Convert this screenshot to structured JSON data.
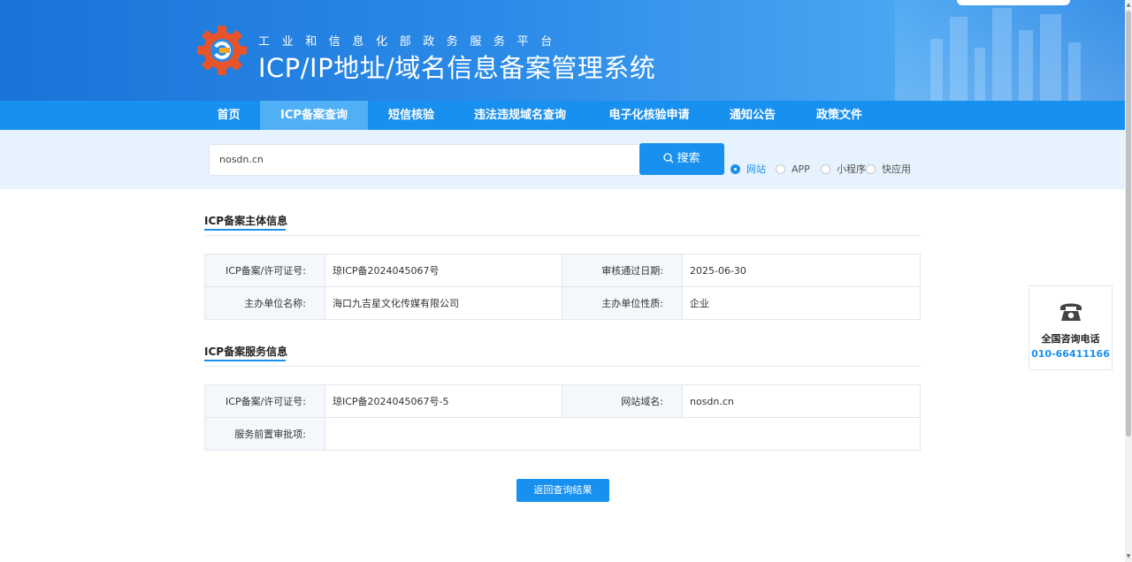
{
  "header": {
    "subtitle": "工业和信息化部政务服务平台",
    "title": "ICP/IP地址/域名信息备案管理系统"
  },
  "nav": [
    {
      "label": "首页",
      "active": false
    },
    {
      "label": "ICP备案查询",
      "active": true
    },
    {
      "label": "短信核验",
      "active": false
    },
    {
      "label": "违法违规域名查询",
      "active": false
    },
    {
      "label": "电子化核验申请",
      "active": false
    },
    {
      "label": "通知公告",
      "active": false
    },
    {
      "label": "政策文件",
      "active": false
    }
  ],
  "search": {
    "value": "nosdn.cn",
    "button_label": "搜索",
    "options": [
      {
        "label": "网站",
        "checked": true
      },
      {
        "label": "APP",
        "checked": false
      },
      {
        "label": "小程序",
        "checked": false
      },
      {
        "label": "快应用",
        "checked": false
      }
    ]
  },
  "subject_info": {
    "title": "ICP备案主体信息",
    "rows": [
      {
        "label1": "ICP备案/许可证号:",
        "value1": "琼ICP备2024045067号",
        "label2": "审核通过日期:",
        "value2": "2025-06-30"
      },
      {
        "label1": "主办单位名称:",
        "value1": "海口九吉星文化传媒有限公司",
        "label2": "主办单位性质:",
        "value2": "企业"
      }
    ]
  },
  "service_info": {
    "title": "ICP备案服务信息",
    "row1": {
      "label1": "ICP备案/许可证号:",
      "value1": "琼ICP备2024045067号-5",
      "label2": "网站域名:",
      "value2": "nosdn.cn"
    },
    "row2": {
      "label1": "服务前置审批项:",
      "value1": ""
    }
  },
  "back_button": "返回查询结果",
  "contact": {
    "label": "全国咨询电话",
    "number": "010-66411166",
    "icon": "phone-icon"
  },
  "colors": {
    "primary": "#1890ef",
    "nav_active": "#4fb0f6",
    "search_band": "#e6f2fd"
  }
}
